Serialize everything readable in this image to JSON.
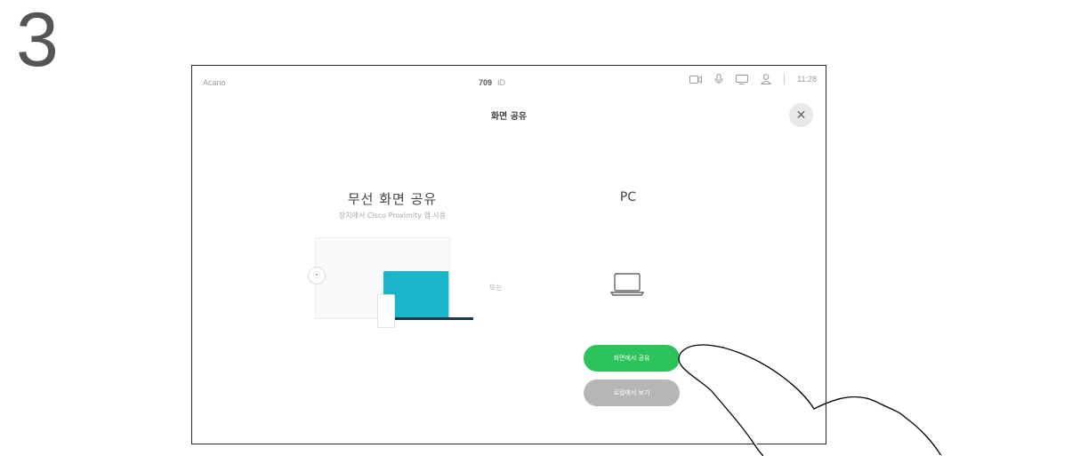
{
  "step": "3",
  "status_bar": {
    "left": "Acano",
    "center_bold": "709",
    "center_text": "ID",
    "time": "11:28",
    "icons": [
      "camera-icon",
      "mic-icon",
      "screen-icon",
      "contacts-icon"
    ]
  },
  "panel": {
    "title": "화면 공유",
    "close_symbol": "✕"
  },
  "wireless": {
    "title": "무선 화면 공유",
    "subtitle": "장치에서 Cisco Proximity 앱 사용",
    "placeholder_glyph": "⦿"
  },
  "or_label": "또는",
  "pc": {
    "title": "PC"
  },
  "buttons": {
    "share": "화면에서 공유",
    "preview": "로컬에서 보기"
  },
  "colors": {
    "accent_green": "#2bc45a",
    "illus_cyan": "#19b6c9",
    "button_grey": "#b6b6b6"
  }
}
